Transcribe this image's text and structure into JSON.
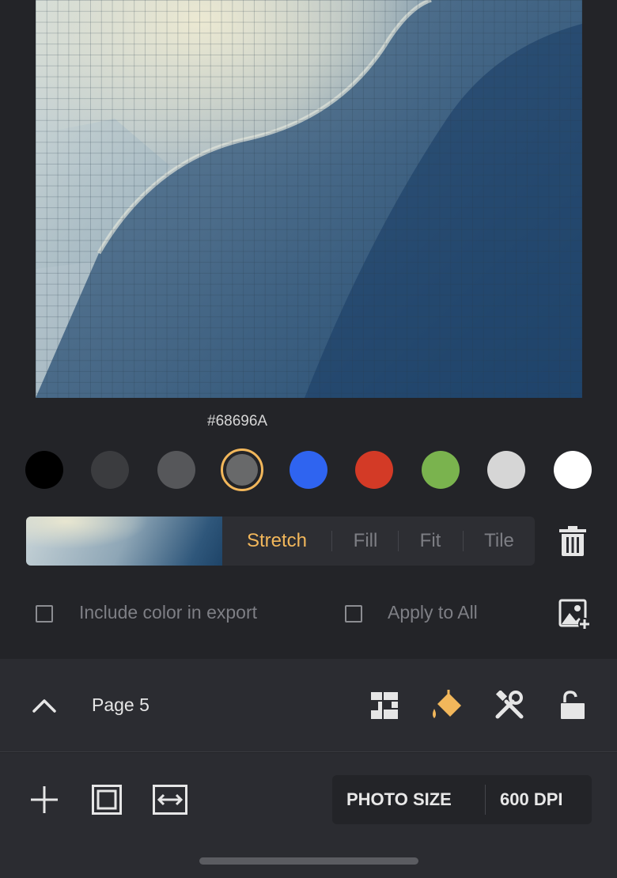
{
  "canvas": {
    "selected_color_hex": "#68696A"
  },
  "swatches": [
    {
      "name": "black",
      "color": "#000000"
    },
    {
      "name": "dark-gray",
      "color": "#3b3c3f"
    },
    {
      "name": "gray",
      "color": "#56575a"
    },
    {
      "name": "selected-gray",
      "color": "#68696A",
      "selected": true
    },
    {
      "name": "blue",
      "color": "#2f64f0"
    },
    {
      "name": "red",
      "color": "#d33a26"
    },
    {
      "name": "green",
      "color": "#7ab34e"
    },
    {
      "name": "light-gray",
      "color": "#d6d6d6"
    },
    {
      "name": "white",
      "color": "#ffffff"
    }
  ],
  "fit_modes": {
    "stretch": "Stretch",
    "fill": "Fill",
    "fit": "Fit",
    "tile": "Tile",
    "active": "Stretch"
  },
  "options": {
    "include_color_label": "Include color in export",
    "apply_all_label": "Apply to All"
  },
  "page_nav": {
    "label": "Page 5"
  },
  "toolbar_icons": [
    "layout-icon",
    "paint-bucket-icon",
    "tools-icon",
    "unlock-icon"
  ],
  "bottom": {
    "photo_size_label": "PHOTO SIZE",
    "dpi_label": "600 DPI"
  },
  "colors": {
    "accent": "#f2b75b",
    "background": "#232428",
    "panel": "#2b2c31"
  }
}
